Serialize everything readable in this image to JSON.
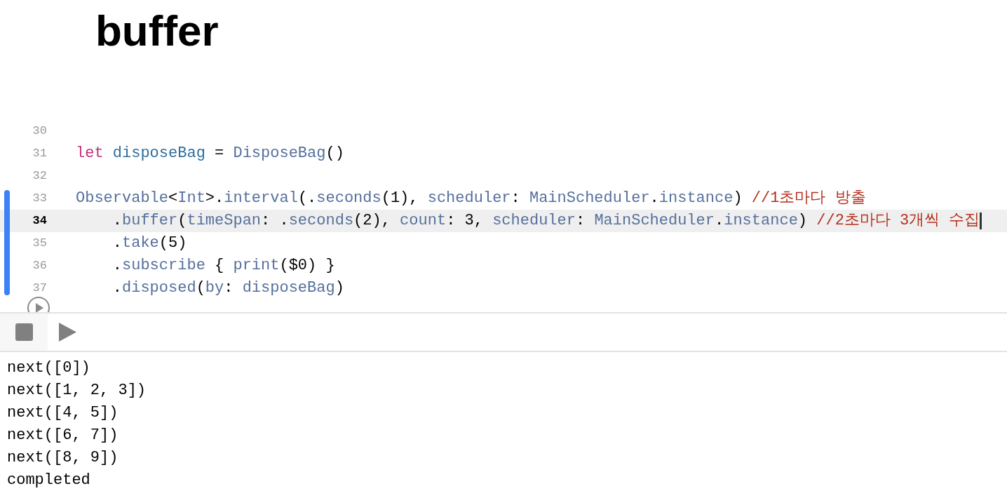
{
  "title": "buffer",
  "editor": {
    "lines": [
      {
        "number": "30",
        "current": false,
        "changed": false
      },
      {
        "number": "31",
        "current": false,
        "changed": false,
        "tokens": [
          {
            "text": "let ",
            "kind": "keyword"
          },
          {
            "text": "disposeBag",
            "kind": "declaration"
          },
          {
            "text": " = ",
            "kind": "plain"
          },
          {
            "text": "DisposeBag",
            "kind": "type"
          },
          {
            "text": "()",
            "kind": "plain"
          }
        ]
      },
      {
        "number": "32",
        "current": false,
        "changed": false
      },
      {
        "number": "33",
        "current": false,
        "changed": true,
        "tokens": [
          {
            "text": "Observable",
            "kind": "type"
          },
          {
            "text": "<",
            "kind": "plain"
          },
          {
            "text": "Int",
            "kind": "type"
          },
          {
            "text": ">.",
            "kind": "plain"
          },
          {
            "text": "interval",
            "kind": "type"
          },
          {
            "text": "(.",
            "kind": "plain"
          },
          {
            "text": "seconds",
            "kind": "type"
          },
          {
            "text": "(1), ",
            "kind": "plain"
          },
          {
            "text": "scheduler",
            "kind": "type"
          },
          {
            "text": ": ",
            "kind": "plain"
          },
          {
            "text": "MainScheduler",
            "kind": "type"
          },
          {
            "text": ".",
            "kind": "plain"
          },
          {
            "text": "instance",
            "kind": "type"
          },
          {
            "text": ") ",
            "kind": "plain"
          },
          {
            "text": "//1초마다 방출",
            "kind": "comment"
          }
        ]
      },
      {
        "number": "34",
        "current": true,
        "changed": true,
        "tokens": [
          {
            "text": "    .",
            "kind": "plain"
          },
          {
            "text": "buffer",
            "kind": "type"
          },
          {
            "text": "(",
            "kind": "plain"
          },
          {
            "text": "timeSpan",
            "kind": "type"
          },
          {
            "text": ": .",
            "kind": "plain"
          },
          {
            "text": "seconds",
            "kind": "type"
          },
          {
            "text": "(2), ",
            "kind": "plain"
          },
          {
            "text": "count",
            "kind": "type"
          },
          {
            "text": ": 3, ",
            "kind": "plain"
          },
          {
            "text": "scheduler",
            "kind": "type"
          },
          {
            "text": ": ",
            "kind": "plain"
          },
          {
            "text": "MainScheduler",
            "kind": "type"
          },
          {
            "text": ".",
            "kind": "plain"
          },
          {
            "text": "instance",
            "kind": "type"
          },
          {
            "text": ") ",
            "kind": "plain"
          },
          {
            "text": "//2초마다 3개씩 수집",
            "kind": "comment"
          }
        ]
      },
      {
        "number": "35",
        "current": false,
        "changed": true,
        "tokens": [
          {
            "text": "    .",
            "kind": "plain"
          },
          {
            "text": "take",
            "kind": "type"
          },
          {
            "text": "(5)",
            "kind": "plain"
          }
        ]
      },
      {
        "number": "36",
        "current": false,
        "changed": true,
        "tokens": [
          {
            "text": "    .",
            "kind": "plain"
          },
          {
            "text": "subscribe",
            "kind": "type"
          },
          {
            "text": " { ",
            "kind": "plain"
          },
          {
            "text": "print",
            "kind": "type"
          },
          {
            "text": "($0) }",
            "kind": "plain"
          }
        ]
      },
      {
        "number": "37",
        "current": false,
        "changed": true,
        "tokens": [
          {
            "text": "    .",
            "kind": "plain"
          },
          {
            "text": "disposed",
            "kind": "type"
          },
          {
            "text": "(",
            "kind": "plain"
          },
          {
            "text": "by",
            "kind": "type"
          },
          {
            "text": ": ",
            "kind": "plain"
          },
          {
            "text": "disposeBag",
            "kind": "type"
          },
          {
            "text": ")",
            "kind": "plain"
          }
        ]
      }
    ]
  },
  "output": [
    "next([0])",
    "next([1, 2, 3])",
    "next([4, 5])",
    "next([6, 7])",
    "next([8, 9])",
    "completed"
  ]
}
